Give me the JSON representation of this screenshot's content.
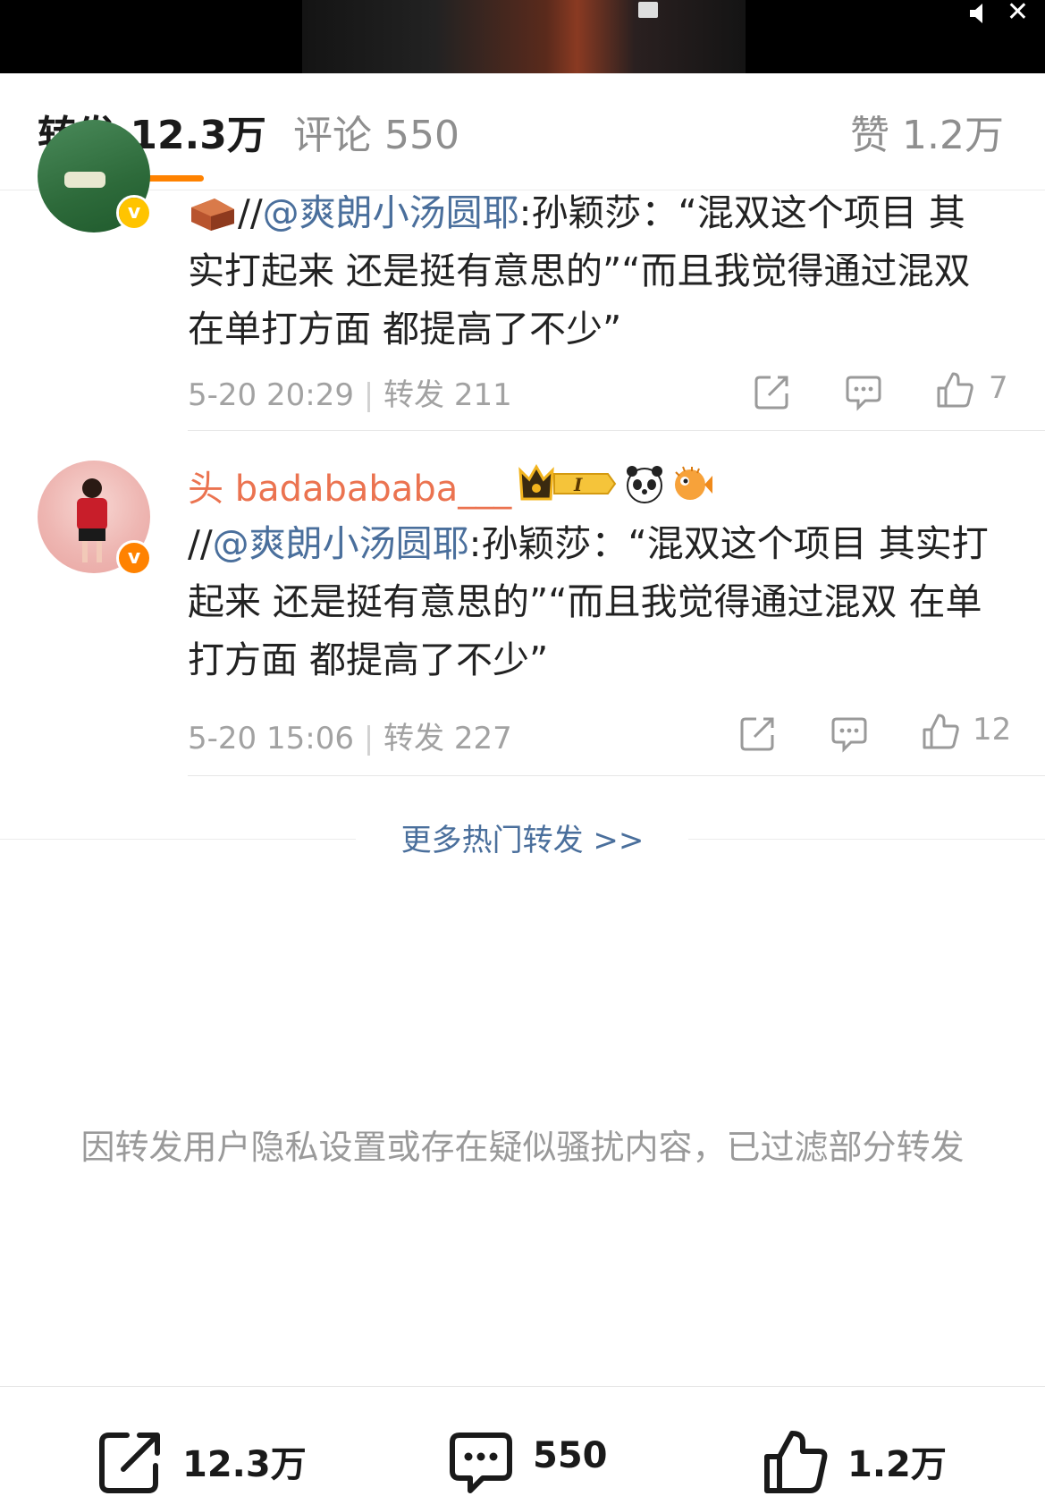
{
  "video": {
    "close_label": "✕"
  },
  "tabs": {
    "repost": {
      "label": "转发",
      "count": "12.3万"
    },
    "comments": {
      "label": "评论",
      "count": "550"
    },
    "likes": {
      "label": "赞",
      "count": "1.2万"
    }
  },
  "reposts": [
    {
      "username": "",
      "emoji": "brick-emoji",
      "prefix": "//",
      "mention": "@爽朗小汤圆耶",
      "text": ":孙颖莎：“混双这个项目 其实打起来 还是挺有意思的”“而且我觉得通过混双 在单打方面 都提高了不少”",
      "time": "5-20 20:29",
      "reposts_label": "转发 211",
      "likes": "7",
      "badge_color": "#ffc400"
    },
    {
      "username": "头 badabababa___",
      "emoji": "",
      "prefix": "//",
      "mention": "@爽朗小汤圆耶",
      "text": ":孙颖莎：“混双这个项目 其实打起来 还是挺有意思的”“而且我觉得通过混双 在单打方面 都提高了不少”",
      "time": "5-20 15:06",
      "reposts_label": "转发 227",
      "likes": "12",
      "badge_color": "#ff8200",
      "badges": [
        "crown-vip-badge",
        "panda-badge",
        "pufferfish-badge"
      ]
    }
  ],
  "more_link": "更多热门转发 >>",
  "filtered_notice": "因转发用户隐私设置或存在疑似骚扰内容，已过滤部分转发",
  "bottom_bar": {
    "repost_count": "12.3万",
    "comment_count": "550",
    "like_count": "1.2万"
  },
  "colors": {
    "accent": "#ff8200",
    "link": "#4a6f9c",
    "username": "#eb7350"
  }
}
